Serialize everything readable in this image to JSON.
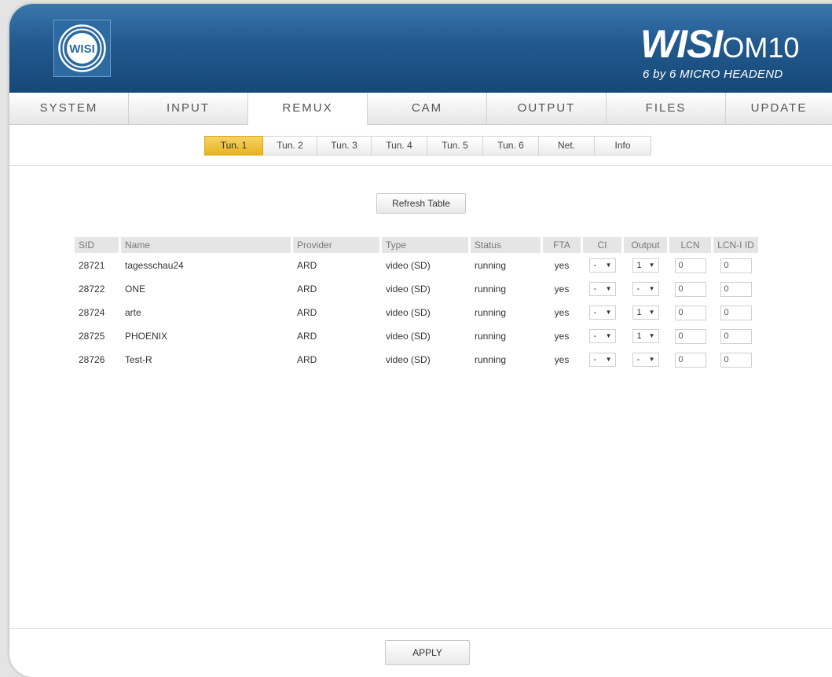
{
  "header": {
    "logo_text": "WISI",
    "brand_name": "WISI",
    "model": "OM10",
    "subtitle": "6 by 6 MICRO HEADEND"
  },
  "main_tabs": [
    {
      "label": "SYSTEM",
      "active": false
    },
    {
      "label": "INPUT",
      "active": false
    },
    {
      "label": "REMUX",
      "active": true
    },
    {
      "label": "CAM",
      "active": false
    },
    {
      "label": "OUTPUT",
      "active": false
    },
    {
      "label": "FILES",
      "active": false
    },
    {
      "label": "UPDATE",
      "active": false
    }
  ],
  "sub_tabs": [
    {
      "label": "Tun. 1",
      "active": true
    },
    {
      "label": "Tun. 2",
      "active": false
    },
    {
      "label": "Tun. 3",
      "active": false
    },
    {
      "label": "Tun. 4",
      "active": false
    },
    {
      "label": "Tun. 5",
      "active": false
    },
    {
      "label": "Tun. 6",
      "active": false
    },
    {
      "label": "Net.",
      "active": false
    },
    {
      "label": "Info",
      "active": false
    }
  ],
  "refresh_label": "Refresh Table",
  "table": {
    "headers": {
      "sid": "SID",
      "name": "Name",
      "provider": "Provider",
      "type": "Type",
      "status": "Status",
      "fta": "FTA",
      "ci": "CI",
      "output": "Output",
      "lcn": "LCN",
      "lcn_id": "LCN-I ID"
    },
    "rows": [
      {
        "sid": "28721",
        "name": "tagesschau24",
        "provider": "ARD",
        "type": "video (SD)",
        "status": "running",
        "fta": "yes",
        "ci": "-",
        "output": "1",
        "lcn": "0",
        "lcn_id": "0"
      },
      {
        "sid": "28722",
        "name": "ONE",
        "provider": "ARD",
        "type": "video (SD)",
        "status": "running",
        "fta": "yes",
        "ci": "-",
        "output": "-",
        "lcn": "0",
        "lcn_id": "0"
      },
      {
        "sid": "28724",
        "name": "arte",
        "provider": "ARD",
        "type": "video (SD)",
        "status": "running",
        "fta": "yes",
        "ci": "-",
        "output": "1",
        "lcn": "0",
        "lcn_id": "0"
      },
      {
        "sid": "28725",
        "name": "PHOENIX",
        "provider": "ARD",
        "type": "video (SD)",
        "status": "running",
        "fta": "yes",
        "ci": "-",
        "output": "1",
        "lcn": "0",
        "lcn_id": "0"
      },
      {
        "sid": "28726",
        "name": "Test-R",
        "provider": "ARD",
        "type": "video (SD)",
        "status": "running",
        "fta": "yes",
        "ci": "-",
        "output": "-",
        "lcn": "0",
        "lcn_id": "0"
      }
    ]
  },
  "apply_label": "APPLY",
  "colors": {
    "header_top": "#3a77ad",
    "header_bottom": "#154878",
    "active_subtab": "#e8b21e"
  }
}
